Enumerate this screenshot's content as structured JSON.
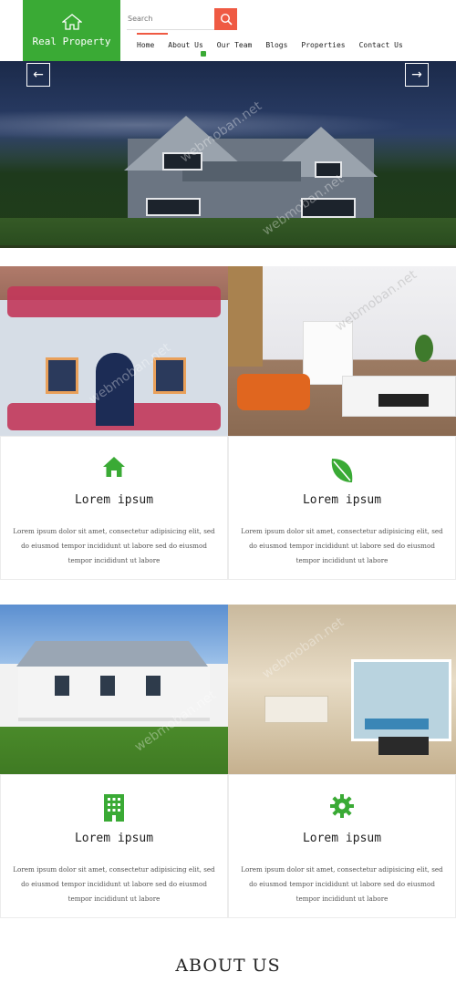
{
  "header": {
    "logo_text": "Real Property",
    "logo_icon": "home-icon",
    "search": {
      "placeholder": "Search",
      "icon": "search-icon"
    },
    "nav": [
      {
        "label": "Home",
        "active": true
      },
      {
        "label": "About Us",
        "active": false
      },
      {
        "label": "Our Team",
        "active": false
      },
      {
        "label": "Blogs",
        "active": false
      },
      {
        "label": "Properties",
        "active": false
      },
      {
        "label": "Contact Us",
        "active": false
      }
    ]
  },
  "hero": {
    "prev_icon": "arrow-left-icon",
    "next_icon": "arrow-right-icon",
    "prev_glyph": "←",
    "next_glyph": "→"
  },
  "features": [
    {
      "icon": "home-icon",
      "title": "Lorem ipsum",
      "text": "Lorem ipsum dolor sit amet, consectetur adipisicing elit, sed do eiusmod tempor incididunt ut labore sed do eiusmod tempor incididunt ut labore"
    },
    {
      "icon": "leaf-icon",
      "title": "Lorem ipsum",
      "text": "Lorem ipsum dolor sit amet, consectetur adipisicing elit, sed do eiusmod tempor incididunt ut labore sed do eiusmod tempor incididunt ut labore"
    },
    {
      "icon": "building-icon",
      "title": "Lorem ipsum",
      "text": "Lorem ipsum dolor sit amet, consectetur adipisicing elit, sed do eiusmod tempor incididunt ut labore sed do eiusmod tempor incididunt ut labore"
    },
    {
      "icon": "gear-icon",
      "title": "Lorem ipsum",
      "text": "Lorem ipsum dolor sit amet, consectetur adipisicing elit, sed do eiusmod tempor incididunt ut labore sed do eiusmod tempor incididunt ut labore"
    }
  ],
  "about": {
    "heading": "ABOUT US"
  },
  "watermark": "webmoban.net",
  "colors": {
    "brand_green": "#3aaa35",
    "accent_red": "#ef5a43"
  }
}
